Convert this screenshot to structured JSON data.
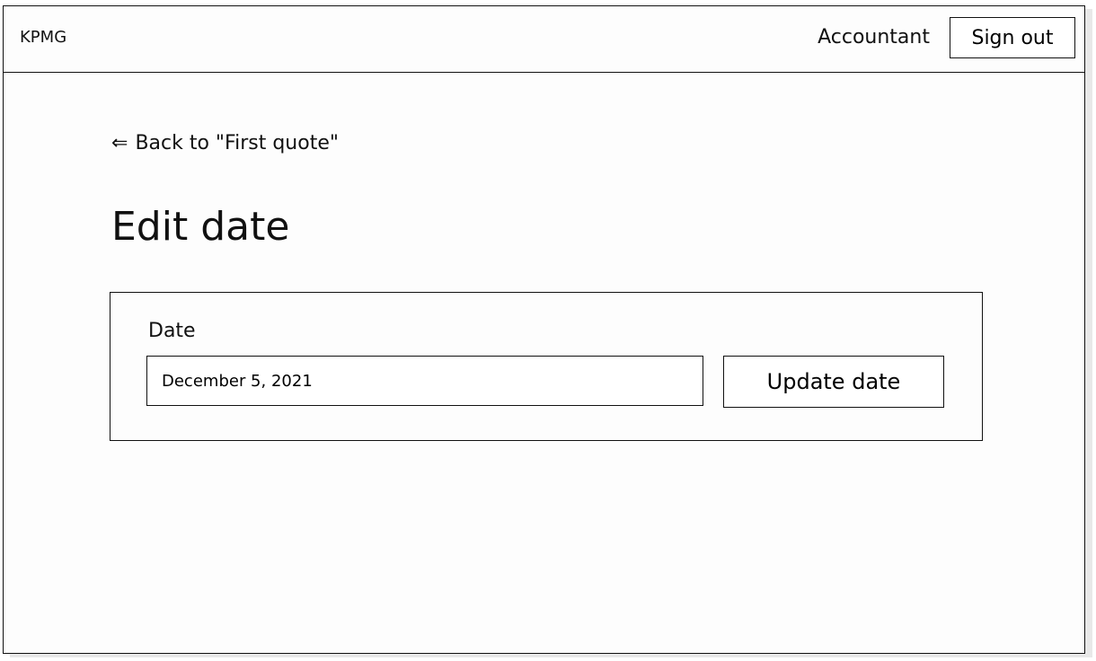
{
  "header": {
    "logo": "KPMG",
    "role": "Accountant",
    "sign_out": "Sign out"
  },
  "nav": {
    "back_icon": "arrow-left-icon",
    "back_label": "Back to \"First quote\""
  },
  "page": {
    "title": "Edit date"
  },
  "form": {
    "date_label": "Date",
    "date_value": "December 5, 2021",
    "submit_label": "Update date"
  }
}
